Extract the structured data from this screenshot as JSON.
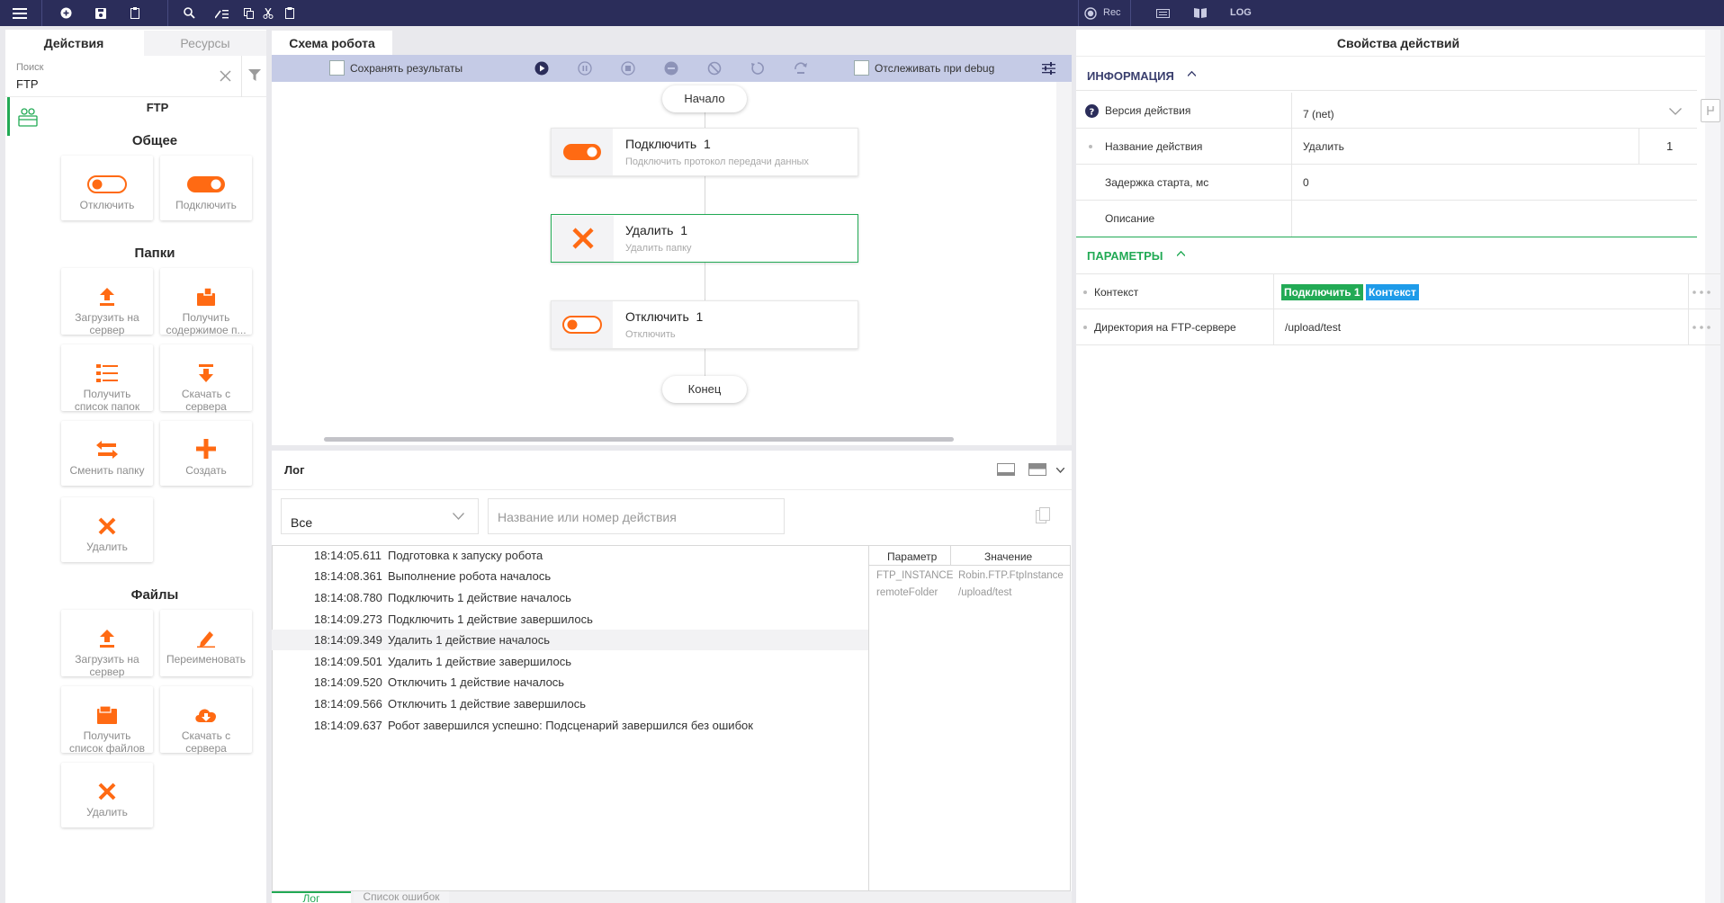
{
  "topbar": {
    "rec_label": "Rec",
    "log_label": "LOG"
  },
  "left": {
    "tabs": [
      "Действия",
      "Ресурсы"
    ],
    "search_label": "Поиск",
    "search_value": "FTP",
    "category": "FTP",
    "sections": {
      "general": {
        "title": "Общее",
        "items": [
          "Отключить",
          "Подключить"
        ]
      },
      "folders": {
        "title": "Папки",
        "items": [
          "Загрузить на\nсервер",
          "Получить\nсодержимое п...",
          "Получить\nсписок папок",
          "Скачать с\nсервера",
          "Сменить папку",
          "Создать",
          "Удалить"
        ]
      },
      "files": {
        "title": "Файлы",
        "items": [
          "Загрузить на\nсервер",
          "Переименовать",
          "Получить\nсписок файлов",
          "Скачать с\nсервера",
          "Удалить"
        ]
      }
    }
  },
  "schema": {
    "tab": "Схема робота",
    "save_results": "Сохранять результаты",
    "track_debug": "Отслеживать при debug",
    "start": "Начало",
    "end": "Конец",
    "nodes": [
      {
        "title": "Подключить",
        "num": "1",
        "sub": "Подключить протокол передачи данных"
      },
      {
        "title": "Удалить",
        "num": "1",
        "sub": "Удалить папку"
      },
      {
        "title": "Отключить",
        "num": "1",
        "sub": "Отключить"
      }
    ]
  },
  "log": {
    "title": "Лог",
    "filter_value": "Все",
    "search_placeholder": "Название или номер действия",
    "rows": [
      {
        "time": "18:14:05.611",
        "msg": "Подготовка к запуску робота"
      },
      {
        "time": "18:14:08.361",
        "msg": "Выполнение робота началось"
      },
      {
        "time": "18:14:08.780",
        "msg": "Подключить 1 действие началось"
      },
      {
        "time": "18:14:09.273",
        "msg": "Подключить 1 действие завершилось"
      },
      {
        "time": "18:14:09.349",
        "msg": "Удалить 1 действие началось"
      },
      {
        "time": "18:14:09.501",
        "msg": "Удалить 1 действие завершилось"
      },
      {
        "time": "18:14:09.520",
        "msg": "Отключить 1 действие началось"
      },
      {
        "time": "18:14:09.566",
        "msg": "Отключить 1 действие завершилось"
      },
      {
        "time": "18:14:09.637",
        "msg": "Робот завершился успешно: Подсценарий завершился без ошибок"
      }
    ],
    "param_headers": [
      "Параметр",
      "Значение"
    ],
    "params": [
      {
        "name": "FTP_INSTANCE",
        "value": "Robin.FTP.FtpInstance"
      },
      {
        "name": "remoteFolder",
        "value": "/upload/test"
      }
    ],
    "bottom_tabs": [
      "Лог",
      "Список ошибок"
    ]
  },
  "props": {
    "title": "Свойства действий",
    "info_header": "ИНФОРМАЦИЯ",
    "params_header": "ПАРАМЕТРЫ",
    "version_label": "Версия действия",
    "version_value": "7 (net)",
    "name_label": "Название действия",
    "name_value": "Удалить",
    "name_num": "1",
    "delay_label": "Задержка старта, мс",
    "delay_value": "0",
    "desc_label": "Описание",
    "context_label": "Контекст",
    "context_tag1": "Подключить 1",
    "context_tag2": "Контекст",
    "dir_label": "Директория на FTP-сервере",
    "dir_value": "/upload/test"
  },
  "colors": {
    "accent": "#ff6a13",
    "green": "#22aa55",
    "blue": "#1e9be9",
    "topbar": "#2b2d5a"
  }
}
